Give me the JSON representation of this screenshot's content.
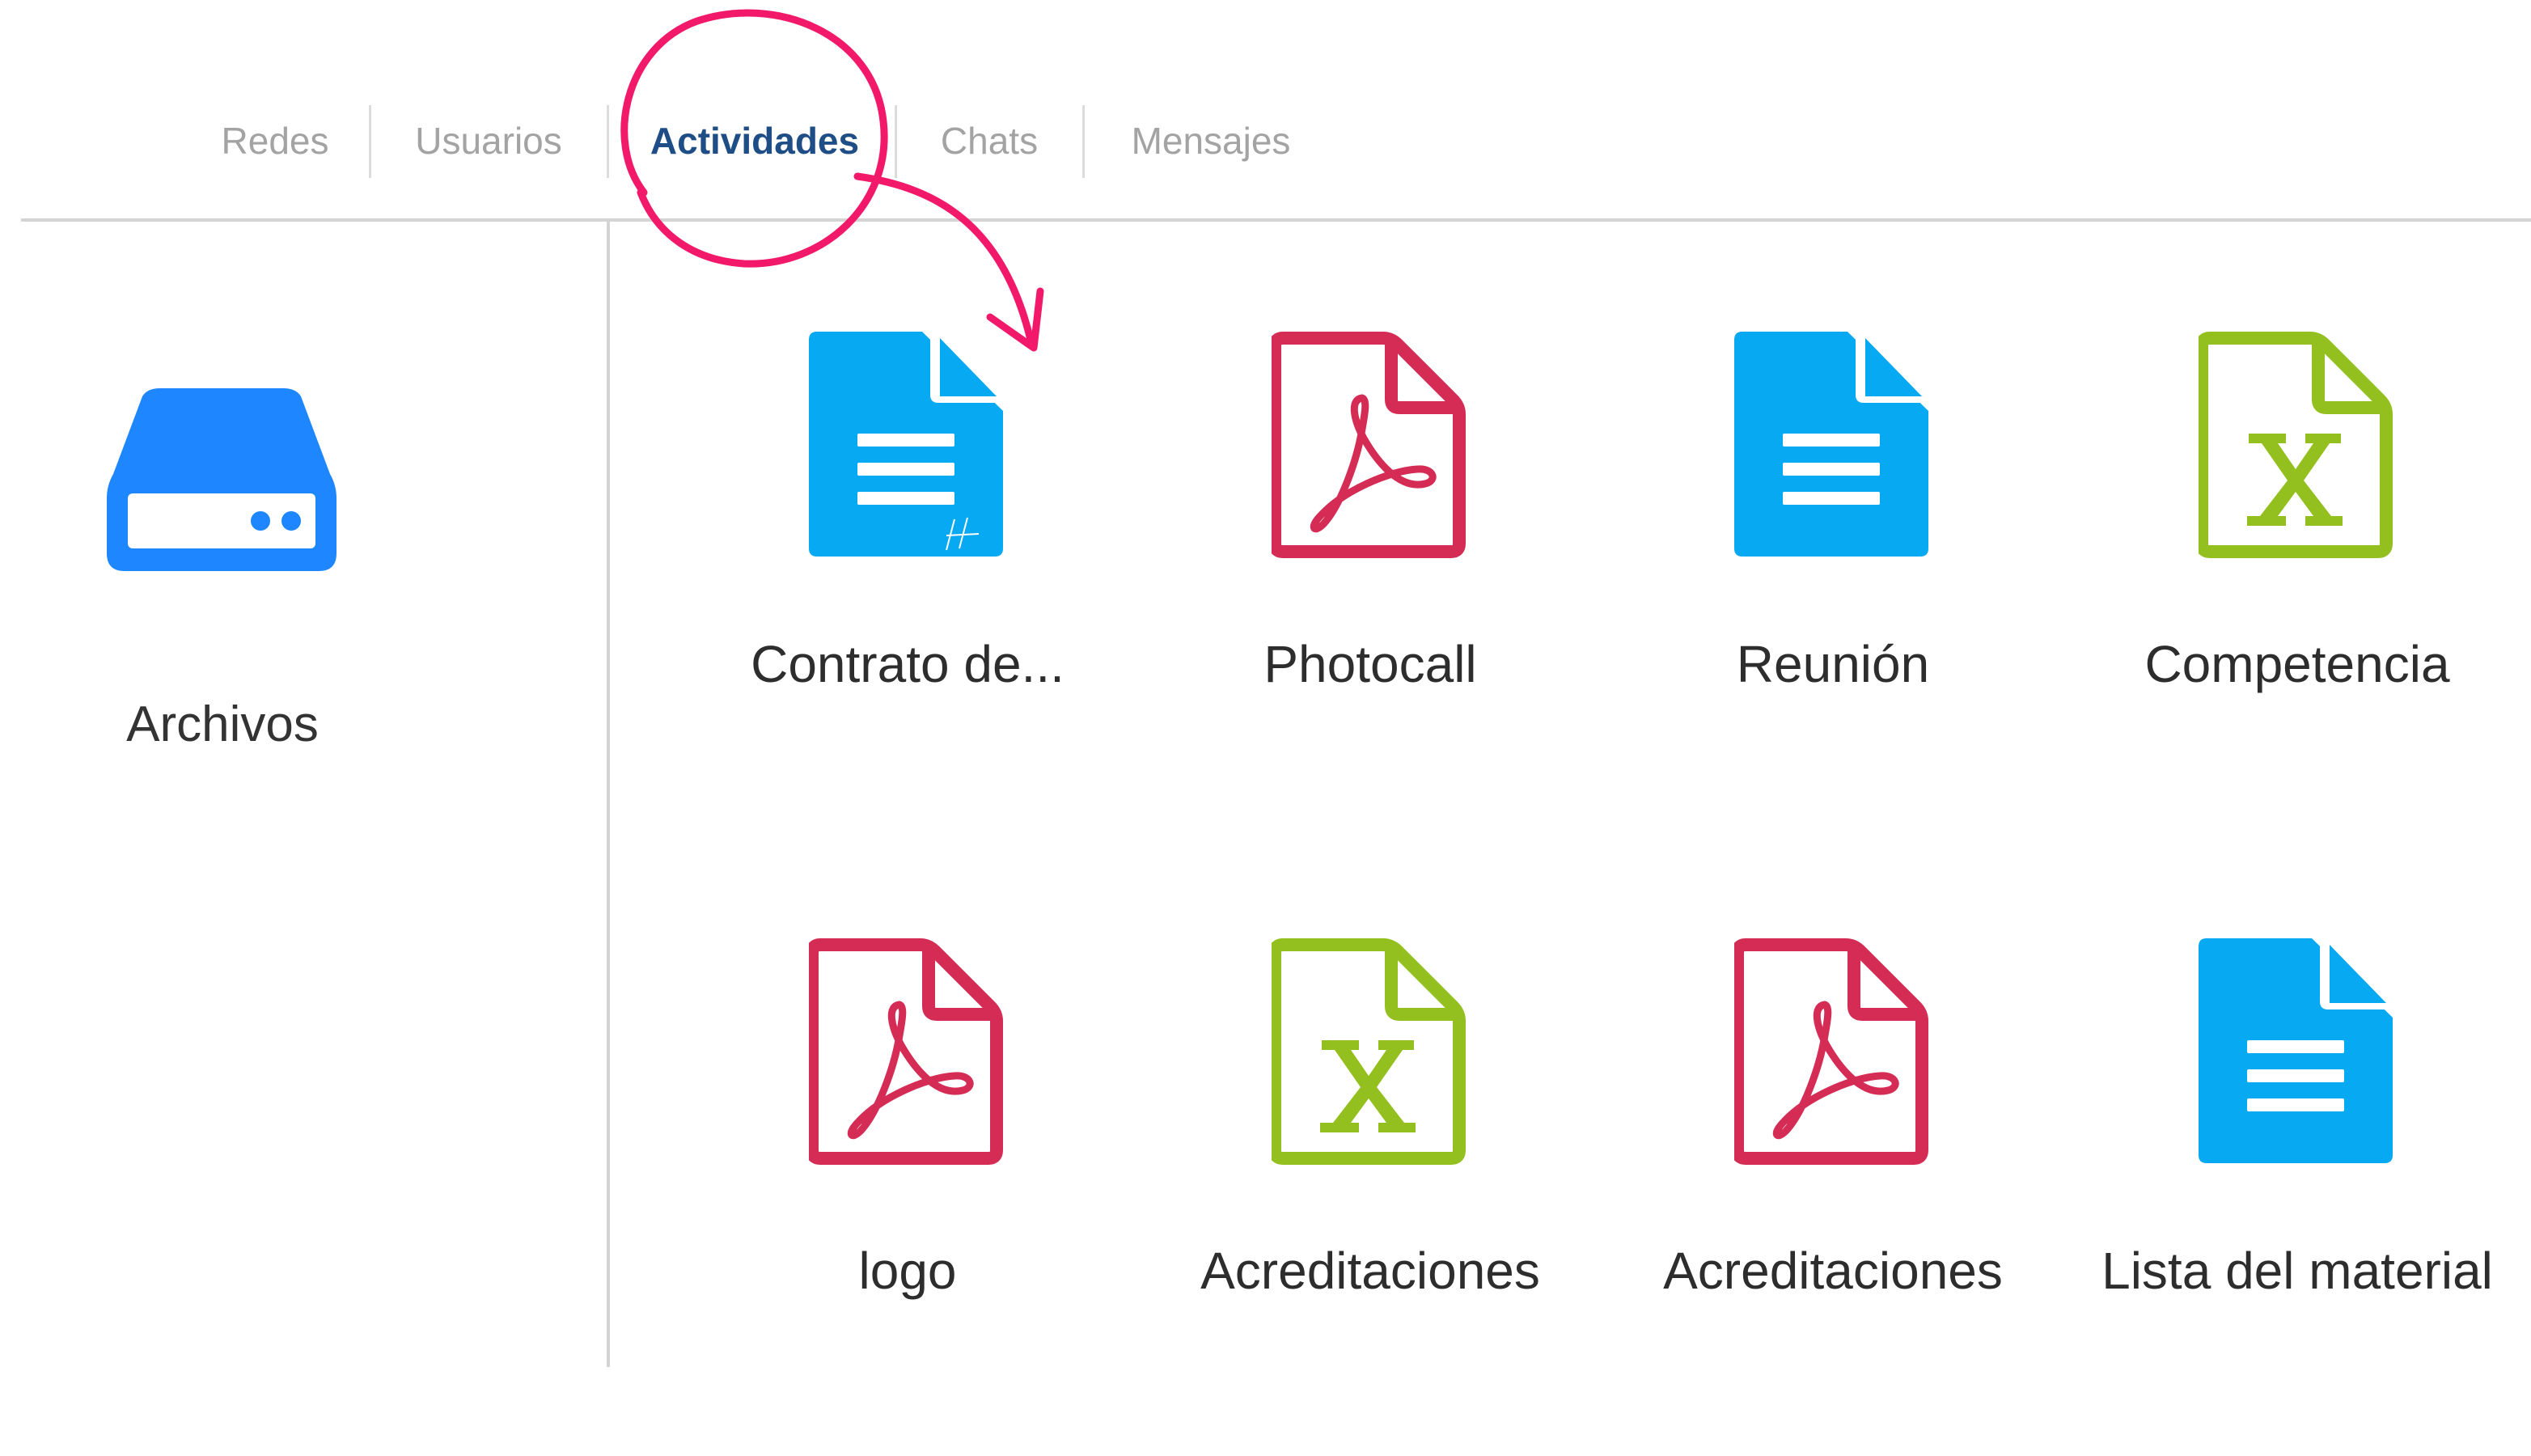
{
  "tabs": [
    {
      "label": "Redes",
      "active": false
    },
    {
      "label": "Usuarios",
      "active": false
    },
    {
      "label": "Actividades",
      "active": true
    },
    {
      "label": "Chats",
      "active": false
    },
    {
      "label": "Mensajes",
      "active": false
    }
  ],
  "sidebar": {
    "item": {
      "label": "Archivos",
      "icon": "drive-icon"
    }
  },
  "files": [
    {
      "label": "Contrato de...",
      "type": "doc",
      "icon": "doc-file-icon"
    },
    {
      "label": "Photocall",
      "type": "pdf",
      "icon": "pdf-file-icon"
    },
    {
      "label": "Reunión",
      "type": "doc",
      "icon": "doc-file-icon"
    },
    {
      "label": "Competencia",
      "type": "xls",
      "icon": "xls-file-icon"
    },
    {
      "label": "logo",
      "type": "pdf",
      "icon": "pdf-file-icon"
    },
    {
      "label": "Acreditaciones",
      "type": "xls",
      "icon": "xls-file-icon"
    },
    {
      "label": "Acreditaciones",
      "type": "pdf",
      "icon": "pdf-file-icon"
    },
    {
      "label": "Lista del material",
      "type": "doc",
      "icon": "doc-file-icon"
    }
  ],
  "colors": {
    "doc": "#07a9f2",
    "pdf": "#d52c55",
    "xls": "#93c01f",
    "drive": "#1e86ff",
    "active_tab": "#1f4e86",
    "annotation": "#f2196b"
  }
}
